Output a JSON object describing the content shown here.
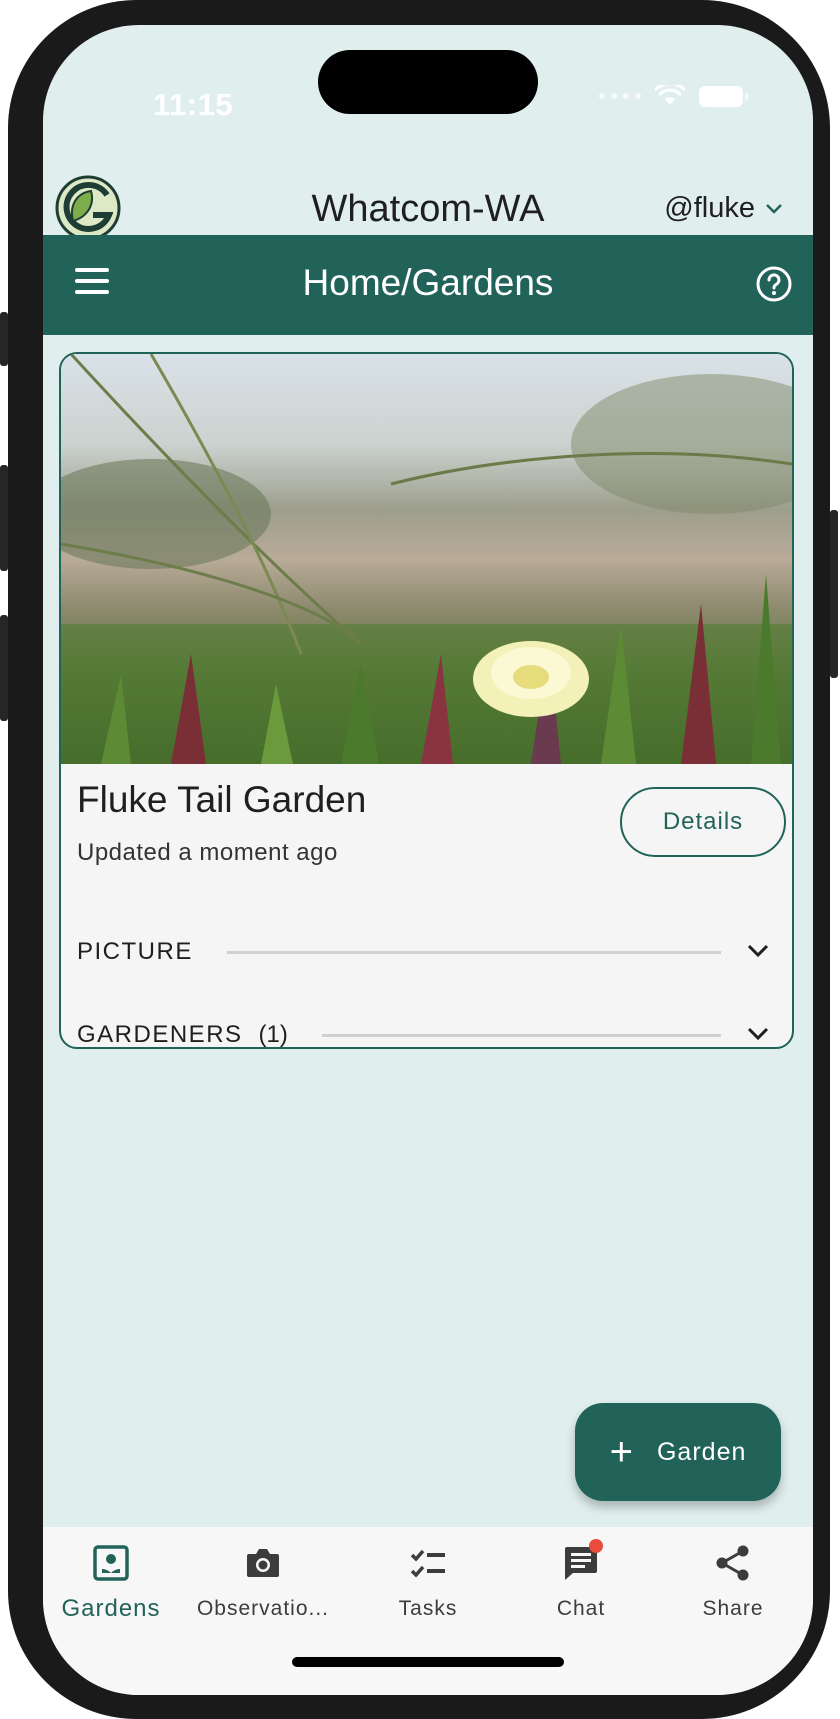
{
  "status_bar": {
    "time": "11:15"
  },
  "header": {
    "region": "Whatcom-WA",
    "user": "@fluke"
  },
  "toolbar": {
    "title": "Home/Gardens"
  },
  "garden_card": {
    "title": "Fluke Tail Garden",
    "updated": "Updated a moment ago",
    "details_label": "Details",
    "sections": [
      {
        "label": "PICTURE",
        "count": ""
      },
      {
        "label": "GARDENERS",
        "count": "(1)"
      }
    ]
  },
  "fab": {
    "label": "Garden"
  },
  "bottom_nav": {
    "items": [
      {
        "label": "Gardens",
        "icon": "garden-icon",
        "active": true
      },
      {
        "label": "Observatio...",
        "icon": "camera-icon",
        "active": false
      },
      {
        "label": "Tasks",
        "icon": "checklist-icon",
        "active": false
      },
      {
        "label": "Chat",
        "icon": "chat-icon",
        "active": false
      },
      {
        "label": "Share",
        "icon": "share-icon",
        "active": false
      }
    ]
  },
  "colors": {
    "primary": "#226359",
    "background": "#e0efee",
    "notification": "#e74c3c"
  }
}
